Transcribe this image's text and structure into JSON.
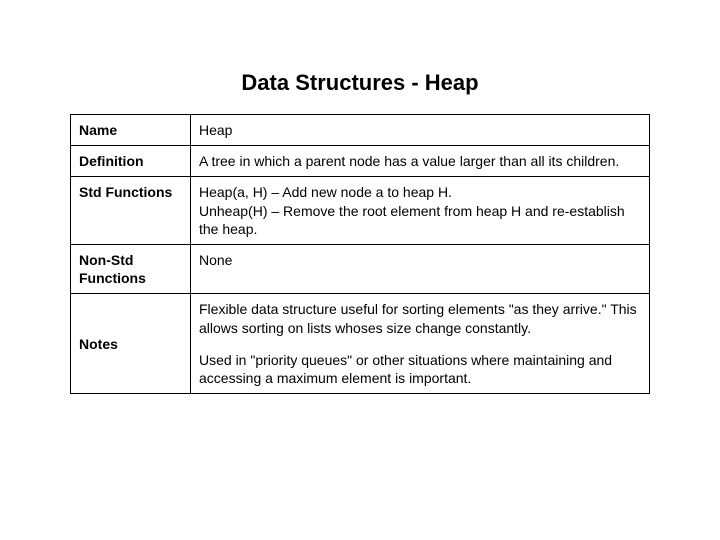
{
  "title": "Data Structures - Heap",
  "rows": {
    "name": {
      "label": "Name",
      "value": "Heap"
    },
    "definition": {
      "label": "Definition",
      "value": "A tree in which a parent node has a value larger than all its children."
    },
    "std_functions": {
      "label": "Std Functions",
      "line1": "Heap(a, H) – Add new node a to heap H.",
      "line2": "Unheap(H) – Remove the root element from heap H and re-establish the heap."
    },
    "non_std_functions": {
      "label": "Non-Std Functions",
      "value": "None"
    },
    "notes": {
      "label": "Notes",
      "para1": "Flexible data structure useful for sorting elements \"as they arrive.\"   This allows sorting on lists whoses size change constantly.",
      "para2": "Used in \"priority queues\" or other situations where maintaining and accessing a maximum element is important."
    }
  }
}
